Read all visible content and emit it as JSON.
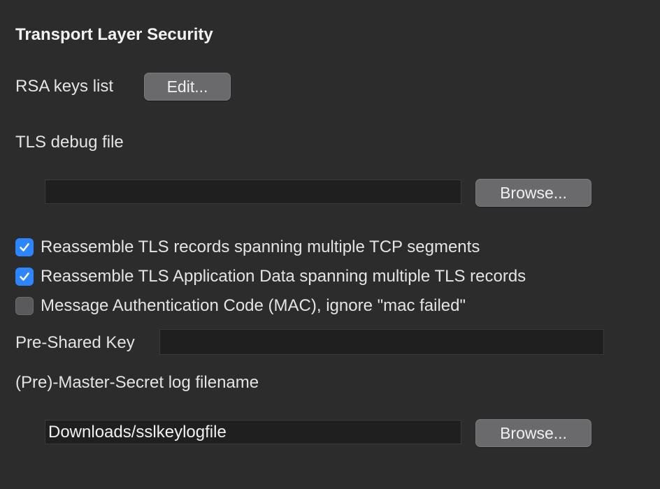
{
  "section": {
    "title": "Transport Layer Security"
  },
  "rsa": {
    "label": "RSA keys list",
    "edit_button": "Edit..."
  },
  "debug": {
    "label": "TLS debug file",
    "value": "",
    "browse_button": "Browse..."
  },
  "options": [
    {
      "label": "Reassemble TLS records spanning multiple TCP segments",
      "checked": true
    },
    {
      "label": "Reassemble TLS Application Data spanning multiple TLS records",
      "checked": true
    },
    {
      "label": "Message Authentication Code (MAC), ignore \"mac failed\"",
      "checked": false
    }
  ],
  "psk": {
    "label": "Pre-Shared Key",
    "value": ""
  },
  "master_secret": {
    "label": "(Pre)-Master-Secret log filename",
    "value": "Downloads/sslkeylogfile",
    "browse_button": "Browse..."
  },
  "colors": {
    "background": "#2c2c2d",
    "checkbox_on": "#2d86ff",
    "button": "#6a6a6c",
    "field": "#1f1f1f"
  },
  "icons": {
    "checked": "checkmark-icon"
  }
}
